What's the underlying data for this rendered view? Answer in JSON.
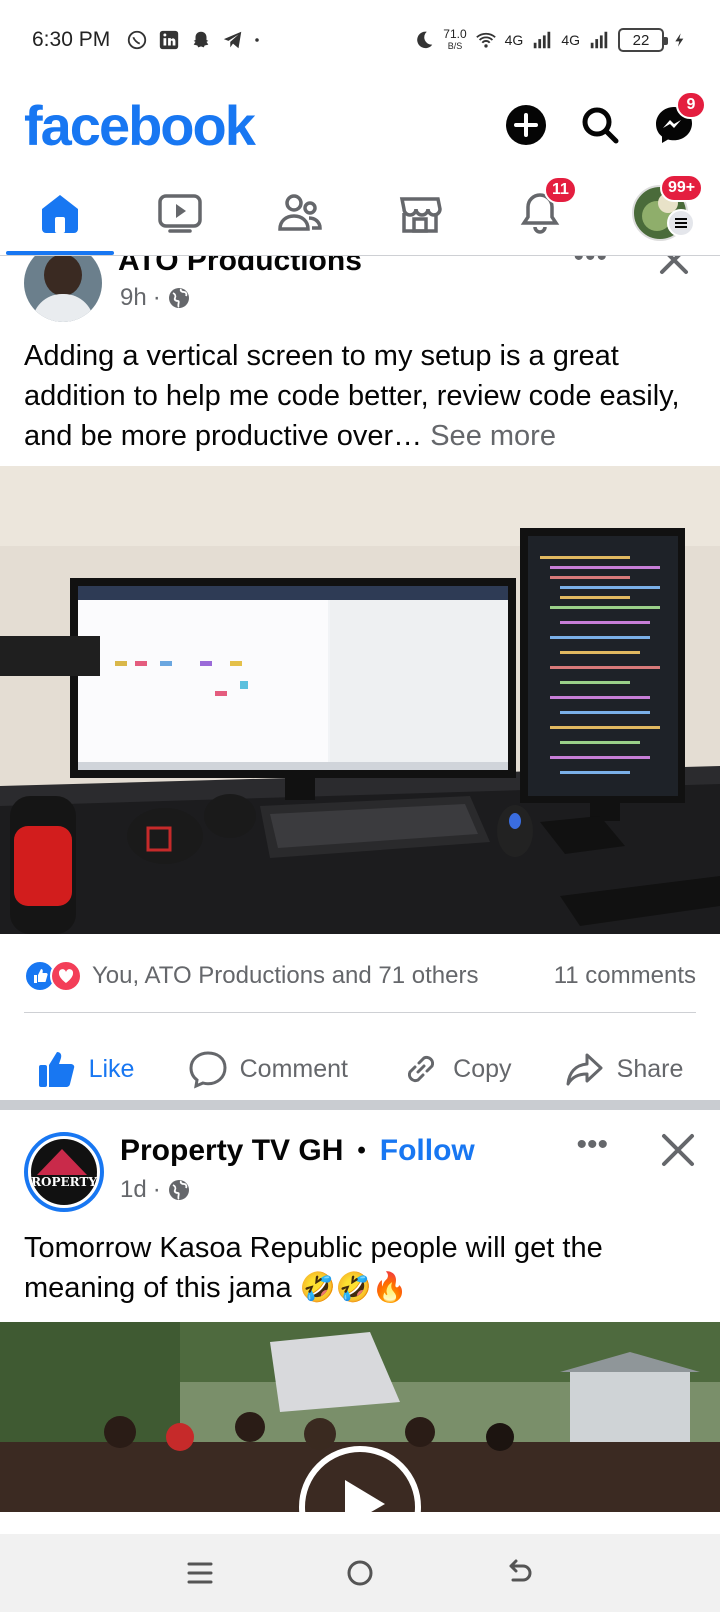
{
  "status_bar": {
    "time": "6:30 PM",
    "net_speed_value": "71.0",
    "net_speed_unit": "B/S",
    "network_1": "4G",
    "network_2": "4G",
    "battery_level": "22",
    "notification_icons": [
      "whatsapp-icon",
      "linkedin-icon",
      "snapchat-icon",
      "telegram-icon",
      "dot-icon"
    ]
  },
  "header": {
    "logo": "facebook",
    "messenger_badge": "9"
  },
  "tabs": [
    {
      "name": "home",
      "active": true
    },
    {
      "name": "watch",
      "active": false
    },
    {
      "name": "friends",
      "active": false
    },
    {
      "name": "marketplace",
      "active": false
    },
    {
      "name": "notifications",
      "active": false,
      "badge": "11"
    },
    {
      "name": "menu",
      "active": false,
      "badge": "99+"
    }
  ],
  "post1": {
    "author": "ATO Productions",
    "time": "9h",
    "more": "•••",
    "text": "Adding a vertical screen to my setup is a great addition to help me code better, review code easily, and be more productive over…",
    "see_more": "See more",
    "reactions_text": "You, ATO Productions and 71 others",
    "comments_text": "11 comments",
    "actions": {
      "like": "Like",
      "comment": "Comment",
      "copy": "Copy",
      "share": "Share"
    }
  },
  "post2": {
    "author": "Property TV GH",
    "dot": "•",
    "follow": "Follow",
    "time": "1d",
    "more": "•••",
    "text": "Tomorrow Kasoa Republic people will get the meaning of this jama 🤣🤣🔥",
    "avatar_text": "ROPERTY"
  },
  "colors": {
    "brand": "#1877f2",
    "badge": "#e41e3f",
    "secondary_text": "#65676b"
  }
}
